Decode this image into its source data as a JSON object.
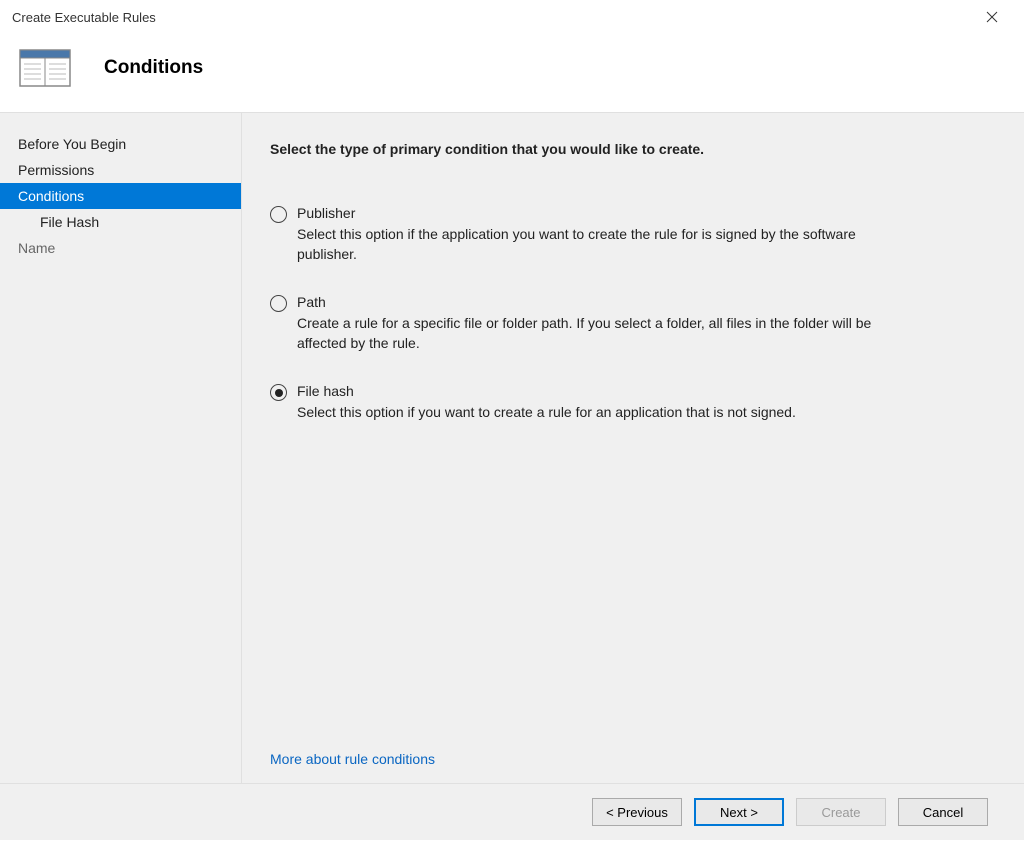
{
  "window": {
    "title": "Create Executable Rules"
  },
  "header": {
    "title": "Conditions"
  },
  "sidebar": {
    "items": [
      {
        "label": "Before You Begin",
        "selected": false,
        "sub": false,
        "disabled": false
      },
      {
        "label": "Permissions",
        "selected": false,
        "sub": false,
        "disabled": false
      },
      {
        "label": "Conditions",
        "selected": true,
        "sub": false,
        "disabled": false
      },
      {
        "label": "File Hash",
        "selected": false,
        "sub": true,
        "disabled": false
      },
      {
        "label": "Name",
        "selected": false,
        "sub": false,
        "disabled": true
      }
    ]
  },
  "main": {
    "prompt": "Select the type of primary condition that you would like to create.",
    "options": [
      {
        "title": "Publisher",
        "description": "Select this option if the application you want to create the rule for is signed by the software publisher.",
        "selected": false
      },
      {
        "title": "Path",
        "description": "Create a rule for a specific file or folder path. If you select a folder, all files in the folder will be affected by the rule.",
        "selected": false
      },
      {
        "title": "File hash",
        "description": "Select this option if you want to create a rule for an application that is not signed.",
        "selected": true
      }
    ],
    "more_link": "More about rule conditions"
  },
  "footer": {
    "previous": "< Previous",
    "next": "Next >",
    "create": "Create",
    "cancel": "Cancel"
  }
}
